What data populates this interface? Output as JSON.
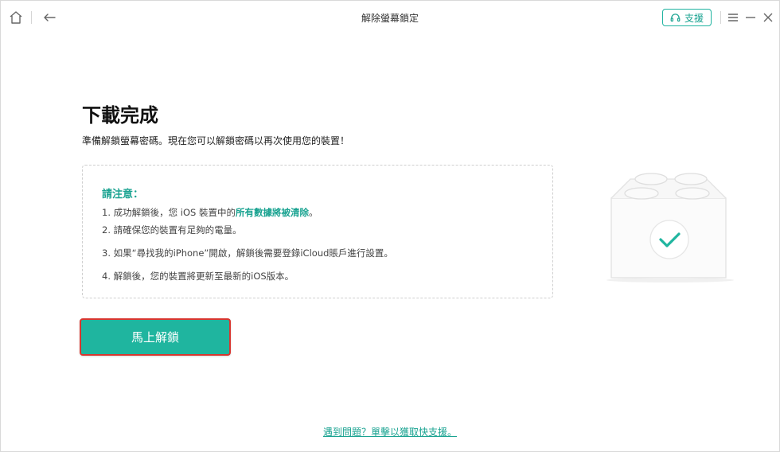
{
  "window": {
    "title": "解除螢幕鎖定"
  },
  "titlebar": {
    "home_icon": "home-icon",
    "back_icon": "back-arrow-icon",
    "support_label": "支援",
    "support_icon": "headset-icon",
    "menu_icon": "hamburger-menu-icon",
    "minimize_icon": "minimize-icon",
    "close_icon": "close-icon"
  },
  "main": {
    "heading": "下載完成",
    "subtext": "準備解鎖螢幕密碼。現在您可以解鎖密碼以再次使用您的裝置！",
    "notice": {
      "title": "請注意：",
      "items": [
        {
          "prefix": "1. 成功解鎖後，您 iOS 裝置中的",
          "highlight": "所有數據將被清除",
          "suffix": "。"
        },
        {
          "text": "2. 請確保您的裝置有足夠的電量。"
        },
        {
          "text": "3. 如果“尋找我的iPhone”開啟，解鎖後需要登錄iCloud賬戶進行設置。"
        },
        {
          "text": "4. 解鎖後，您的裝置將更新至最新的iOS版本。"
        }
      ]
    },
    "unlock_button": "馬上解鎖",
    "help_link": "遇到問題？單擊以獲取快支援。"
  },
  "colors": {
    "accent": "#1fb59f",
    "button_border": "#d9362f",
    "text": "#333333"
  }
}
